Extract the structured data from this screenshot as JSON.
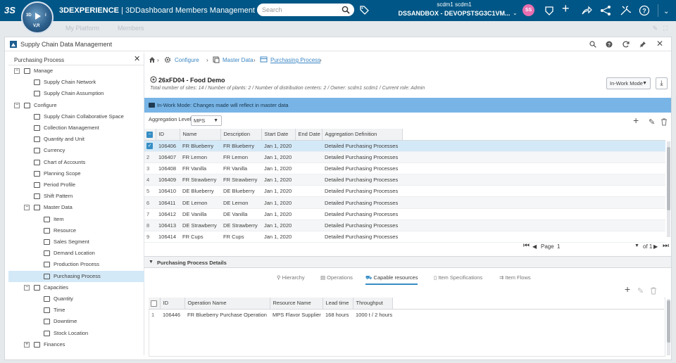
{
  "topbar": {
    "brand_bold": "3DEXPERIENCE",
    "brand_rest": " | 3DDashboard  Members Management",
    "search_placeholder": "Search",
    "user_name": "scdm1 scdm1",
    "tenant": "DSSANDBOX - DEVOPSTSG3C1VM...",
    "avatar_initials": "SS",
    "compass": {
      "top": "3D",
      "right": "i",
      "bottom": "V,R"
    },
    "logo": "3S"
  },
  "dashboard_tabs": [
    "My Platform",
    "Members"
  ],
  "panel": {
    "title": "Supply Chain Data Management"
  },
  "left": {
    "title": "Purchasing Process",
    "tree": [
      {
        "label": "Manage",
        "level": 1,
        "expander": "−",
        "icon": "clipboard-icon"
      },
      {
        "label": "Supply Chain Network",
        "level": 2,
        "icon": "network-icon"
      },
      {
        "label": "Supply Chain Assumption",
        "level": 2,
        "icon": "assumption-icon"
      },
      {
        "label": "Configure",
        "level": 1,
        "expander": "−",
        "icon": "gear-icon"
      },
      {
        "label": "Supply Chain Collaborative Space",
        "level": 2,
        "icon": "space-icon"
      },
      {
        "label": "Collection Management",
        "level": 2,
        "icon": "collection-icon"
      },
      {
        "label": "Quantity and Unit",
        "level": 2,
        "icon": "scale-icon"
      },
      {
        "label": "Currency",
        "level": 2,
        "icon": "currency-icon"
      },
      {
        "label": "Chart of Accounts",
        "level": 2,
        "icon": "accounts-icon"
      },
      {
        "label": "Planning Scope",
        "level": 2,
        "icon": "scope-icon"
      },
      {
        "label": "Period Profile",
        "level": 2,
        "icon": "calendar-icon"
      },
      {
        "label": "Shift Pattern",
        "level": 2,
        "icon": "shift-icon"
      },
      {
        "label": "Master Data",
        "level": 2,
        "expander": "−",
        "icon": "master-data-icon"
      },
      {
        "label": "Item",
        "level": 3,
        "icon": "item-icon"
      },
      {
        "label": "Resource",
        "level": 3,
        "icon": "truck-icon"
      },
      {
        "label": "Sales Segment",
        "level": 3,
        "icon": "segment-icon"
      },
      {
        "label": "Demand Location",
        "level": 3,
        "icon": "location-icon"
      },
      {
        "label": "Production Process",
        "level": 3,
        "icon": "production-icon"
      },
      {
        "label": "Purchasing Process",
        "level": 3,
        "icon": "purchasing-icon",
        "selected": true
      },
      {
        "label": "Capacities",
        "level": 2,
        "expander": "−",
        "icon": "capacities-icon"
      },
      {
        "label": "Quantity",
        "level": 3,
        "icon": "grid-icon"
      },
      {
        "label": "Time",
        "level": 3,
        "icon": "grid-icon"
      },
      {
        "label": "Downtime",
        "level": 3,
        "icon": "grid-icon"
      },
      {
        "label": "Stock Location",
        "level": 3,
        "icon": "stock-icon"
      },
      {
        "label": "Finances",
        "level": 2,
        "expander": "+",
        "icon": "finances-icon"
      }
    ]
  },
  "breadcrumb": [
    "Configure",
    "Master Data",
    "Purchasing Process"
  ],
  "header": {
    "title": "26xFD04 - Food Demo",
    "subtitle": "Total number of sites: 14 / Number of plants: 2 / Number of distribution centers: 2 / Owner: scdm1 scdm1 / Current role: Admin",
    "mode": "In-Work Mode"
  },
  "banner": "In-Work Mode: Changes made will reflect in master data",
  "aggregation": {
    "label": "Aggregation Level",
    "value": "MPS"
  },
  "grid": {
    "columns": [
      "ID",
      "Name",
      "Description",
      "Start Date",
      "End Date",
      "Aggregation Definition"
    ],
    "rows": [
      {
        "n": "",
        "id": "106406",
        "name": "FR Blueberry",
        "desc": "FR Blueberry",
        "start": "Jan 1, 2020",
        "end": "",
        "agg": "Detailed Purchasing Processes"
      },
      {
        "n": "2",
        "id": "106407",
        "name": "FR Lemon",
        "desc": "FR Lemon",
        "start": "Jan 1, 2020",
        "end": "",
        "agg": "Detailed Purchasing Processes"
      },
      {
        "n": "3",
        "id": "106408",
        "name": "FR Vanilla",
        "desc": "FR Vanilla",
        "start": "Jan 1, 2020",
        "end": "",
        "agg": "Detailed Purchasing Processes"
      },
      {
        "n": "4",
        "id": "106409",
        "name": "FR Strawberry",
        "desc": "FR Strawberry",
        "start": "Jan 1, 2020",
        "end": "",
        "agg": "Detailed Purchasing Processes"
      },
      {
        "n": "5",
        "id": "106410",
        "name": "DE Blueberry",
        "desc": "DE Blueberry",
        "start": "Jan 1, 2020",
        "end": "",
        "agg": "Detailed Purchasing Processes"
      },
      {
        "n": "6",
        "id": "106411",
        "name": "DE Lemon",
        "desc": "DE Lemon",
        "start": "Jan 1, 2020",
        "end": "",
        "agg": "Detailed Purchasing Processes"
      },
      {
        "n": "7",
        "id": "106412",
        "name": "DE Vanilla",
        "desc": "DE Vanilla",
        "start": "Jan 1, 2020",
        "end": "",
        "agg": "Detailed Purchasing Processes"
      },
      {
        "n": "8",
        "id": "106413",
        "name": "DE Strawberry",
        "desc": "DE Strawberry",
        "start": "Jan 1, 2020",
        "end": "",
        "agg": "Detailed Purchasing Processes"
      },
      {
        "n": "9",
        "id": "106414",
        "name": "FR Cups",
        "desc": "FR Cups",
        "start": "Jan 1, 2020",
        "end": "",
        "agg": "Detailed Purchasing Processes"
      }
    ]
  },
  "pager": {
    "label": "Page",
    "current": "1",
    "of": "of 1"
  },
  "details": {
    "title": "Purchasing Process Details",
    "tabs": [
      "Hierarchy",
      "Operations",
      "Capable resources",
      "Item Specifications",
      "Item Flows"
    ],
    "active_tab": "Capable resources",
    "columns": [
      "ID",
      "Operation Name",
      "Resource Name",
      "Lead time",
      "Throughput"
    ],
    "rows": [
      {
        "n": "1",
        "id": "106446",
        "op": "FR Blueberry Purchase Operation",
        "res": "MPS Flavor Supplier",
        "lead": "168 hours",
        "thr": "1000 t / 2 hours"
      }
    ]
  },
  "colors": {
    "topbar": "#005686",
    "banner": "#78b5e6",
    "selected_row": "#d4e9f7",
    "accent": "#368ec4"
  }
}
